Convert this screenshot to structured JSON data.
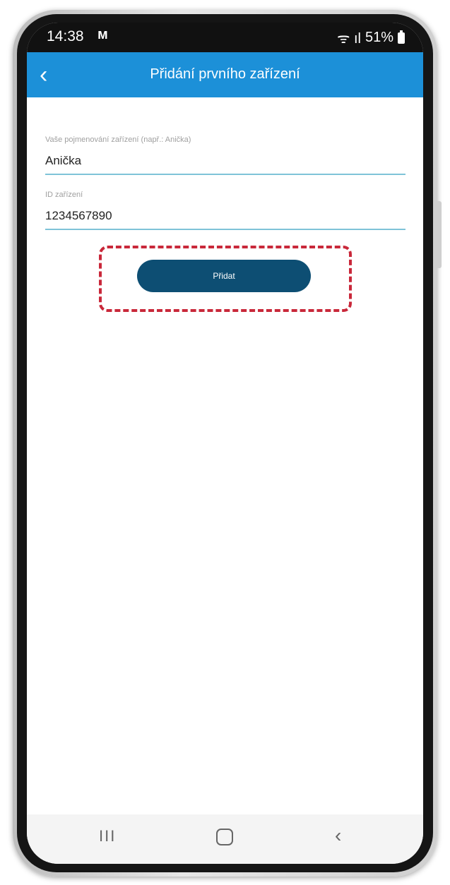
{
  "status_bar": {
    "time": "14:38",
    "notification_glyph": "ᴍ",
    "signal_text": "ᯤ ıl",
    "battery": "51%"
  },
  "app_bar": {
    "back_icon": "‹",
    "title": "Přidání prvního zařízení"
  },
  "form": {
    "name_field": {
      "label": "Vaše pojmenování zařízení (např.: Anička)",
      "value": "Anička"
    },
    "id_field": {
      "label": "ID zařízení",
      "value": "1234567890"
    }
  },
  "add_button": {
    "label": "Přidat"
  },
  "nav_bar": {
    "recents": "III",
    "back": "‹"
  },
  "colors": {
    "app_bar": "#1c90d8",
    "button": "#0d4e73",
    "highlight": "#c9283a",
    "field_line": "#7fc3d8"
  }
}
